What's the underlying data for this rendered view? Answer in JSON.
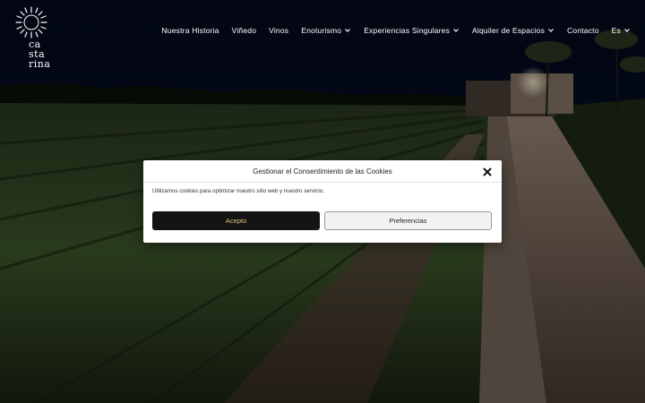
{
  "brand": {
    "logo_lines": [
      "ca",
      "sta",
      "rina"
    ],
    "logo_icon": "sun-icon"
  },
  "nav": {
    "items": [
      {
        "label": "Nuestra Historia",
        "has_dropdown": false
      },
      {
        "label": "Viñedo",
        "has_dropdown": false
      },
      {
        "label": "Vinos",
        "has_dropdown": false
      },
      {
        "label": "Enoturismo",
        "has_dropdown": true
      },
      {
        "label": "Experiencias Singulares",
        "has_dropdown": true
      },
      {
        "label": "Alquiler de Espacios",
        "has_dropdown": true
      },
      {
        "label": "Contacto",
        "has_dropdown": false
      },
      {
        "label": "Es",
        "has_dropdown": true
      }
    ]
  },
  "cookie_modal": {
    "title": "Gestionar el Consentimiento de las Cookies",
    "text": "Utilizamos cookies para optimizar nuestro sitio web y nuestro servicio.",
    "accept_label": "Acepto",
    "preferences_label": "Preferencias",
    "close_icon": "close-icon"
  },
  "colors": {
    "accept_bg": "#141414",
    "accept_text": "#d9c07a",
    "modal_bg": "#ffffff"
  }
}
